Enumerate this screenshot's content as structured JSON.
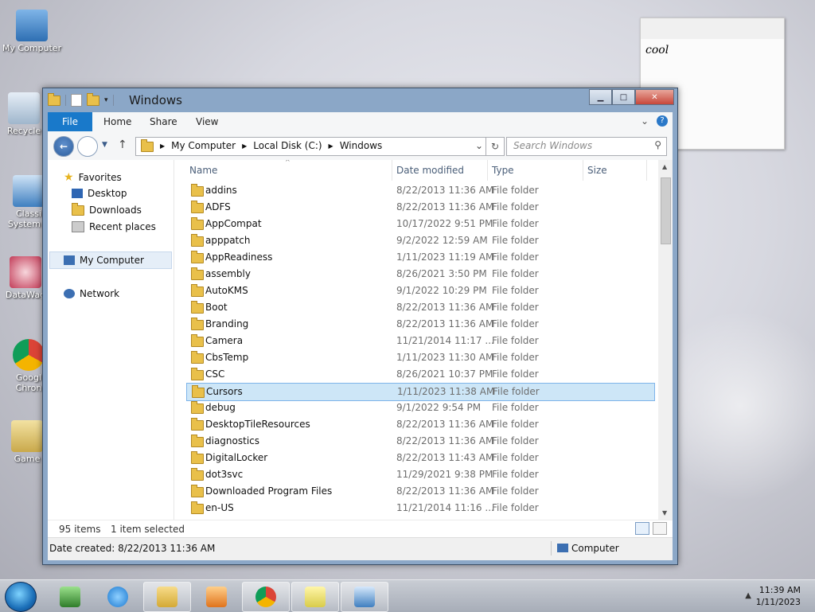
{
  "desktop": {
    "icons": [
      {
        "label": "My Computer"
      },
      {
        "label": "Recycle"
      },
      {
        "label": "Classi System C"
      },
      {
        "label": "DataWag"
      },
      {
        "label": "Googl Chron"
      },
      {
        "label": "Game"
      }
    ]
  },
  "note": {
    "text": "cool"
  },
  "window": {
    "title": "Windows",
    "ribbon_tabs": [
      "File",
      "Home",
      "Share",
      "View"
    ],
    "address": {
      "crumbs": [
        "My Computer",
        "Local Disk (C:)",
        "Windows"
      ]
    },
    "search": {
      "placeholder": "Search Windows"
    },
    "nav": {
      "favorites": "Favorites",
      "desktop": "Desktop",
      "downloads": "Downloads",
      "recent": "Recent places",
      "computer": "My Computer",
      "network": "Network"
    },
    "columns": {
      "name": "Name",
      "date": "Date modified",
      "type": "Type",
      "size": "Size"
    },
    "files": [
      {
        "name": "addins",
        "date": "8/22/2013 11:36 AM",
        "type": "File folder"
      },
      {
        "name": "ADFS",
        "date": "8/22/2013 11:36 AM",
        "type": "File folder"
      },
      {
        "name": "AppCompat",
        "date": "10/17/2022 9:51 PM",
        "type": "File folder"
      },
      {
        "name": "apppatch",
        "date": "9/2/2022 12:59 AM",
        "type": "File folder"
      },
      {
        "name": "AppReadiness",
        "date": "1/11/2023 11:19 AM",
        "type": "File folder"
      },
      {
        "name": "assembly",
        "date": "8/26/2021 3:50 PM",
        "type": "File folder"
      },
      {
        "name": "AutoKMS",
        "date": "9/1/2022 10:29 PM",
        "type": "File folder"
      },
      {
        "name": "Boot",
        "date": "8/22/2013 11:36 AM",
        "type": "File folder"
      },
      {
        "name": "Branding",
        "date": "8/22/2013 11:36 AM",
        "type": "File folder"
      },
      {
        "name": "Camera",
        "date": "11/21/2014 11:17 ...",
        "type": "File folder"
      },
      {
        "name": "CbsTemp",
        "date": "1/11/2023 11:30 AM",
        "type": "File folder"
      },
      {
        "name": "CSC",
        "date": "8/26/2021 10:37 PM",
        "type": "File folder"
      },
      {
        "name": "Cursors",
        "date": "1/11/2023 11:38 AM",
        "type": "File folder",
        "selected": true
      },
      {
        "name": "debug",
        "date": "9/1/2022 9:54 PM",
        "type": "File folder"
      },
      {
        "name": "DesktopTileResources",
        "date": "8/22/2013 11:36 AM",
        "type": "File folder"
      },
      {
        "name": "diagnostics",
        "date": "8/22/2013 11:36 AM",
        "type": "File folder"
      },
      {
        "name": "DigitalLocker",
        "date": "8/22/2013 11:43 AM",
        "type": "File folder"
      },
      {
        "name": "dot3svc",
        "date": "11/29/2021 9:38 PM",
        "type": "File folder"
      },
      {
        "name": "Downloaded Program Files",
        "date": "8/22/2013 11:36 AM",
        "type": "File folder"
      },
      {
        "name": "en-US",
        "date": "11/21/2014 11:16 ...",
        "type": "File folder"
      }
    ],
    "status": {
      "items": "95 items",
      "selected": "1 item selected"
    },
    "details": {
      "created": "Date created: 8/22/2013 11:36 AM",
      "location": "Computer"
    }
  },
  "taskbar": {
    "time": "11:39 AM",
    "date": "1/11/2023"
  },
  "colors": {
    "ribbon_file": "#1979ca",
    "selection": "#cde6f7",
    "window_frame": "#8ba7c7"
  }
}
